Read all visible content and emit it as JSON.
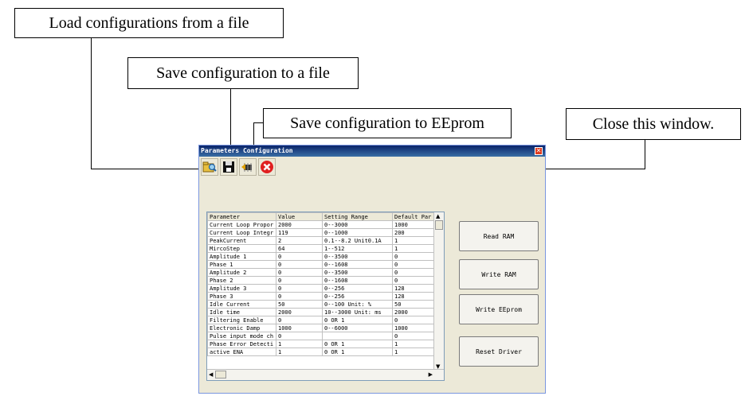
{
  "callouts": {
    "load": "Load configurations from a file",
    "save_file": "Save configuration to a file",
    "save_eeprom": "Save configuration to EEprom",
    "close": "Close this window."
  },
  "window": {
    "title": "Parameters Configuration"
  },
  "toolbar": {
    "icons": [
      "open-file-icon",
      "save-file-icon",
      "eeprom-write-icon",
      "close-icon"
    ]
  },
  "table": {
    "columns": [
      "Parameter",
      "Value",
      "Setting Range",
      "Default Par"
    ],
    "rows": [
      [
        "Current Loop Propor",
        "2000",
        "0--3000",
        "1000"
      ],
      [
        "Current Loop Integr",
        "119",
        "0--1000",
        "200"
      ],
      [
        "PeakCurrent",
        "2",
        "0.1--8.2 Unit0.1A",
        "1"
      ],
      [
        "MircoStep",
        "64",
        "1--512",
        "1"
      ],
      [
        "Amplitude 1",
        "0",
        "0--3500",
        "0"
      ],
      [
        "Phase 1",
        "0",
        "0--1608",
        "0"
      ],
      [
        "Amplitude 2",
        "0",
        "0--3500",
        "0"
      ],
      [
        "Phase 2",
        "0",
        "0--1608",
        "0"
      ],
      [
        "Amplitude 3",
        "0",
        "0--256",
        "128"
      ],
      [
        "Phase 3",
        "0",
        "0--256",
        "128"
      ],
      [
        "Idle Current",
        "50",
        "0--100 Unit: %",
        "50"
      ],
      [
        "Idle time",
        "2000",
        "10--3000 Unit: ms",
        "2000"
      ],
      [
        "Filtering Enable",
        "0",
        "0 OR 1",
        "0"
      ],
      [
        "Electronic Damp",
        "1000",
        "0--6000",
        "1000"
      ],
      [
        "Pulse input mode ch",
        "0",
        "",
        "0"
      ],
      [
        "Phase Error Detecti",
        "1",
        "0 OR 1",
        "1"
      ],
      [
        "active ENA",
        "1",
        "0 OR 1",
        "1"
      ]
    ]
  },
  "buttons": {
    "read_ram": "Read RAM",
    "write_ram": "Write RAM",
    "write_eeprom": "Write EEprom",
    "reset_driver": "Reset Driver"
  }
}
